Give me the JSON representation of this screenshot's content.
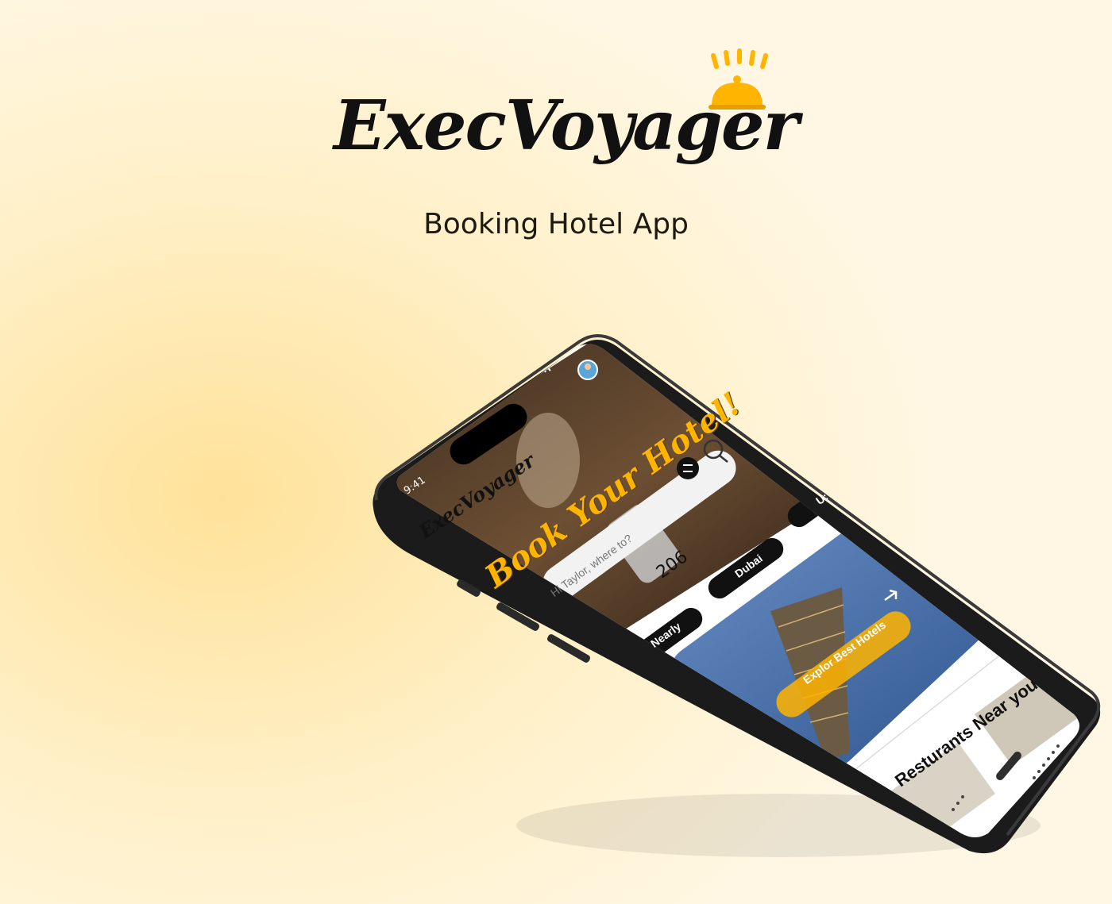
{
  "brand": {
    "logo": "ExecVoyager",
    "subtitle": "Booking Hotel App"
  },
  "phone": {
    "status_bar": {
      "time": "9:41"
    },
    "app_logo": "ExecVoyager",
    "headline": "Book Your Hotel!",
    "search": {
      "placeholder": "Hi Taylor, where to?"
    },
    "room_number": "206",
    "chips": [
      "Nearly",
      "Dubai",
      "U:"
    ],
    "featured_cta": "Explor Best Hotels",
    "section_title": "Resturants Near you"
  },
  "colors": {
    "accent": "#ffb400",
    "background": "#fff3d6",
    "phone_frame": "#1b1b1b",
    "chip": "#111111"
  },
  "icons": [
    "bell-icon",
    "signal-icon",
    "wifi-icon",
    "battery-icon",
    "avatar",
    "filter-icon",
    "search-icon",
    "arrow-right-icon"
  ]
}
